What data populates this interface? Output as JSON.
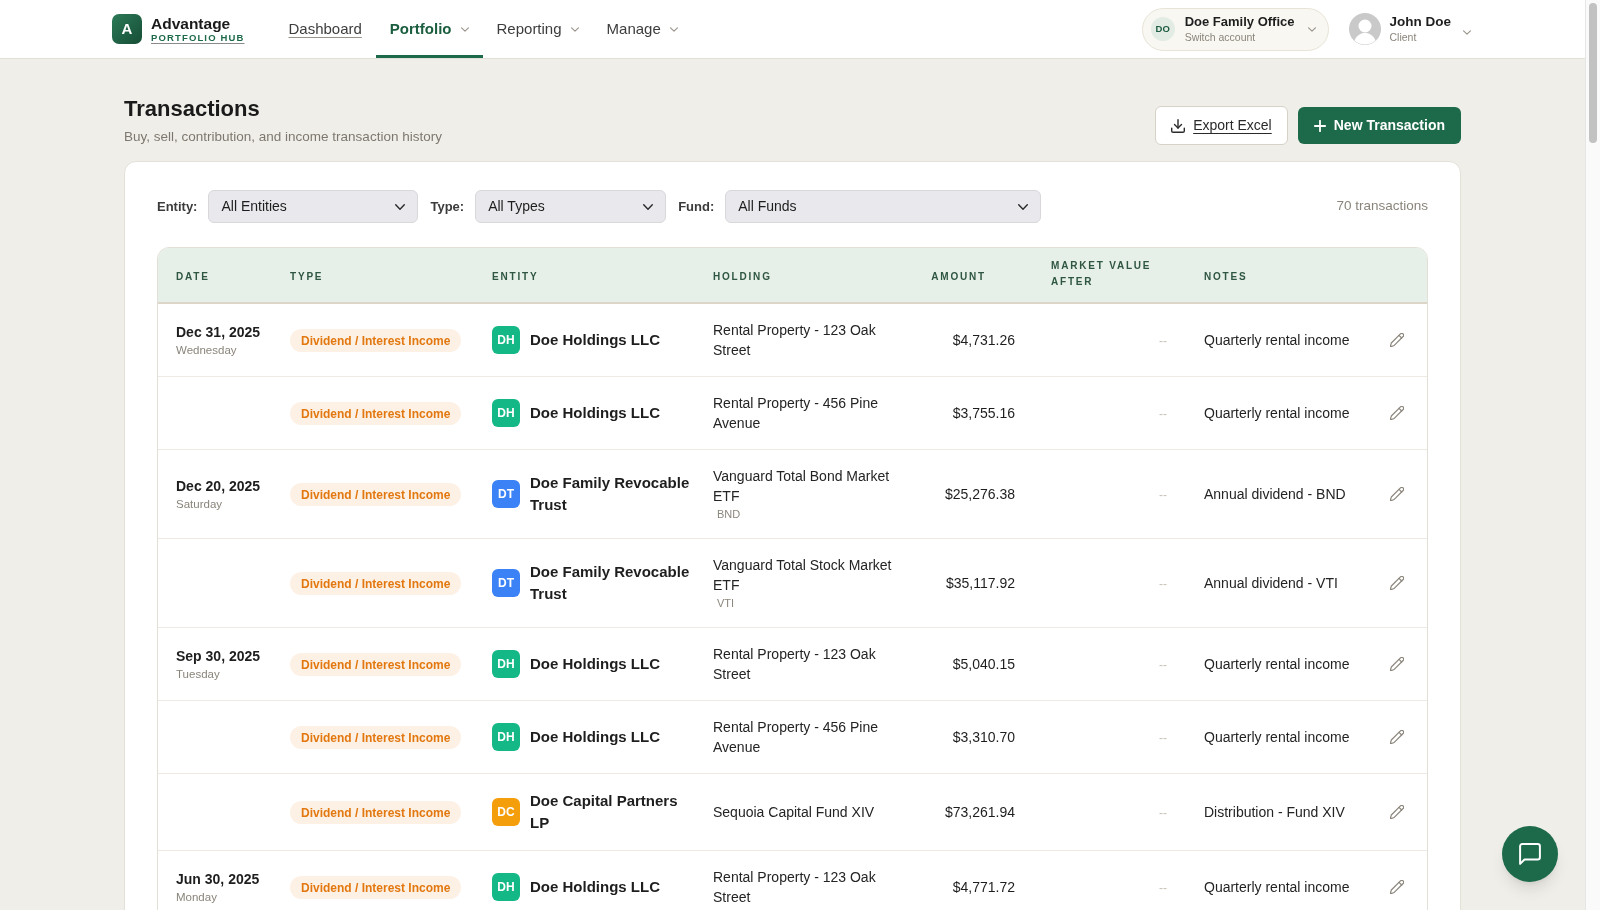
{
  "brand": {
    "logo_letter": "A",
    "name": "Advantage",
    "tagline": "PORTFOLIO HUB"
  },
  "nav": [
    {
      "label": "Dashboard",
      "kind": "link",
      "selected": false
    },
    {
      "label": "Portfolio",
      "kind": "menu",
      "selected": true
    },
    {
      "label": "Reporting",
      "kind": "menu",
      "selected": false
    },
    {
      "label": "Manage",
      "kind": "menu",
      "selected": false
    }
  ],
  "account": {
    "initials": "DO",
    "name": "Doe Family Office",
    "hint": "Switch account"
  },
  "user": {
    "name": "John Doe",
    "role": "Client"
  },
  "page": {
    "title": "Transactions",
    "subtitle": "Buy, sell, contribution, and income transaction history"
  },
  "actions": [
    {
      "label": "Export Excel",
      "kind": "secondary"
    },
    {
      "label": "New Transaction",
      "kind": "primary"
    }
  ],
  "filters": [
    {
      "label": "Entity:",
      "value": "All Entities"
    },
    {
      "label": "Type:",
      "value": "All Types"
    },
    {
      "label": "Fund:",
      "value": "All Funds"
    }
  ],
  "transaction_count": "70 transactions",
  "table": {
    "columns": [
      "DATE",
      "TYPE",
      "ENTITY",
      "HOLDING",
      "AMOUNT",
      "MARKET VALUE AFTER",
      "NOTES"
    ],
    "rows": [
      {
        "date": "Dec 31, 2025",
        "weekday": "Wednesday",
        "type": "Dividend / Interest Income",
        "entity": {
          "initials": "DH",
          "name": "Doe Holdings LLC",
          "color": "#14b886"
        },
        "holding": {
          "name": "Rental Property - 123 Oak Street"
        },
        "amount": "$4,731.26",
        "market_value_after": "--",
        "notes": "Quarterly rental income"
      },
      {
        "type": "Dividend / Interest Income",
        "entity": {
          "initials": "DH",
          "name": "Doe Holdings LLC",
          "color": "#14b886"
        },
        "holding": {
          "name": "Rental Property - 456 Pine Avenue"
        },
        "amount": "$3,755.16",
        "market_value_after": "--",
        "notes": "Quarterly rental income"
      },
      {
        "date": "Dec 20, 2025",
        "weekday": "Saturday",
        "type": "Dividend / Interest Income",
        "entity": {
          "initials": "DT",
          "name": "Doe Family Revocable Trust",
          "color": "#3b82f6"
        },
        "holding": {
          "name": "Vanguard Total Bond Market ETF",
          "ticker": "BND"
        },
        "amount": "$25,276.38",
        "market_value_after": "--",
        "notes": "Annual dividend - BND"
      },
      {
        "type": "Dividend / Interest Income",
        "entity": {
          "initials": "DT",
          "name": "Doe Family Revocable Trust",
          "color": "#3b82f6"
        },
        "holding": {
          "name": "Vanguard Total Stock Market ETF",
          "ticker": "VTI"
        },
        "amount": "$35,117.92",
        "market_value_after": "--",
        "notes": "Annual dividend - VTI"
      },
      {
        "date": "Sep 30, 2025",
        "weekday": "Tuesday",
        "type": "Dividend / Interest Income",
        "entity": {
          "initials": "DH",
          "name": "Doe Holdings LLC",
          "color": "#14b886"
        },
        "holding": {
          "name": "Rental Property - 123 Oak Street"
        },
        "amount": "$5,040.15",
        "market_value_after": "--",
        "notes": "Quarterly rental income"
      },
      {
        "type": "Dividend / Interest Income",
        "entity": {
          "initials": "DH",
          "name": "Doe Holdings LLC",
          "color": "#14b886"
        },
        "holding": {
          "name": "Rental Property - 456 Pine Avenue"
        },
        "amount": "$3,310.70",
        "market_value_after": "--",
        "notes": "Quarterly rental income"
      },
      {
        "type": "Dividend / Interest Income",
        "entity": {
          "initials": "DC",
          "name": "Doe Capital Partners LP",
          "color": "#f59e0b"
        },
        "holding": {
          "name": "Sequoia Capital Fund XIV"
        },
        "amount": "$73,261.94",
        "market_value_after": "--",
        "notes": "Distribution - Fund XIV"
      },
      {
        "date": "Jun 30, 2025",
        "weekday": "Monday",
        "type": "Dividend / Interest Income",
        "entity": {
          "initials": "DH",
          "name": "Doe Holdings LLC",
          "color": "#14b886"
        },
        "holding": {
          "name": "Rental Property - 123 Oak Street"
        },
        "amount": "$4,771.72",
        "market_value_after": "--",
        "notes": "Quarterly rental income"
      }
    ]
  }
}
